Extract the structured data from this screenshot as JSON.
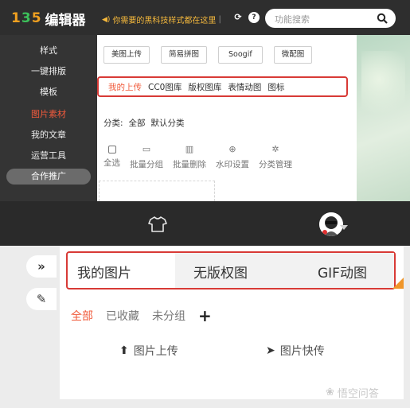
{
  "editor": {
    "logo_mark": "135",
    "logo_name": "编辑器",
    "notice": "你需要的黑科技样式都在这里",
    "search_placeholder": "功能搜索",
    "sidebar": [
      "样式",
      "一键排版",
      "模板",
      "图片素材",
      "我的文章",
      "运营工具",
      "合作推广"
    ],
    "active_sidebar": "图片素材",
    "buttons": [
      "美图上传",
      "简易拼图",
      "Soogif",
      "微配图"
    ],
    "tabs": [
      "我的上传",
      "CC0图库",
      "版权图库",
      "表情动图",
      "图标"
    ],
    "active_tab": "我的上传",
    "category_label": "分类:",
    "categories": [
      "全部",
      "默认分类"
    ],
    "tools": [
      "全选",
      "批量分组",
      "批量删除",
      "水印设置",
      "分类管理"
    ]
  },
  "images_panel": {
    "tabs": [
      "我的图片",
      "无版权图",
      "GIF动图"
    ],
    "filters": [
      "全部",
      "已收藏",
      "未分组"
    ],
    "active_filter": "全部",
    "add": "+",
    "upload": "图片上传",
    "quick_upload": "图片快传",
    "side_buttons": [
      "»",
      "✎"
    ]
  },
  "watermark": "悟空问答",
  "colors": {
    "accent_red": "#d83a36",
    "active_orange": "#f05a3a",
    "notice_yellow": "#f6b93c",
    "corner_orange": "#f0962a"
  }
}
